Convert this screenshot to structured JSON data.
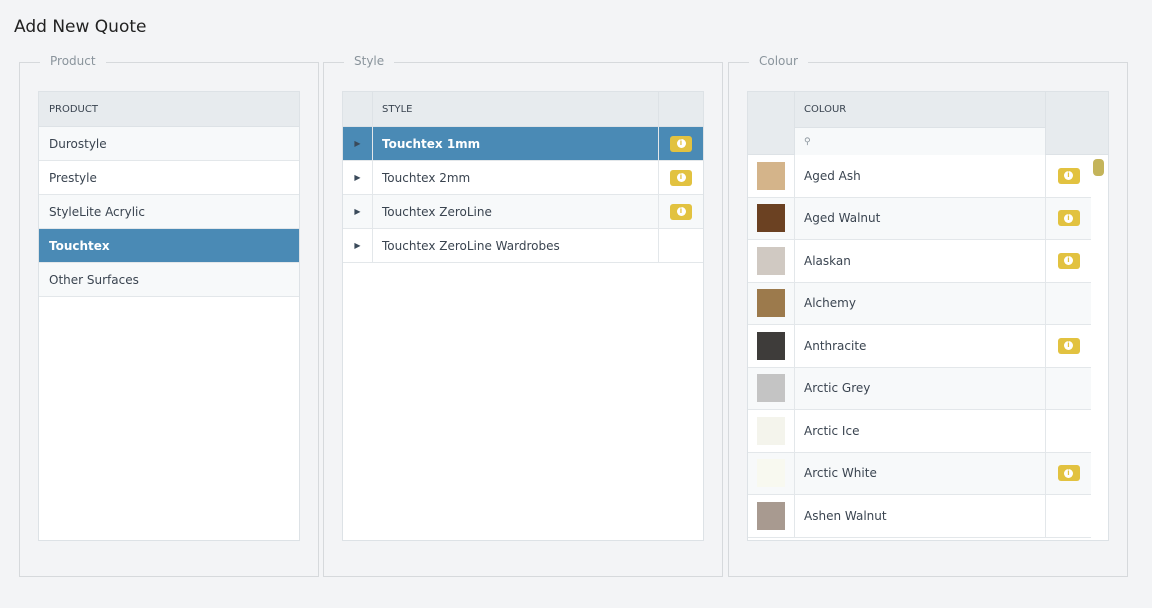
{
  "title": "Add New Quote",
  "product": {
    "legend": "Product",
    "header": "PRODUCT",
    "items": [
      "Durostyle",
      "Prestyle",
      "StyleLite Acrylic",
      "Touchtex",
      "Other Surfaces"
    ],
    "selected": 3
  },
  "style": {
    "legend": "Style",
    "header": "STYLE",
    "items": [
      {
        "name": "Touchtex 1mm",
        "info": true
      },
      {
        "name": "Touchtex 2mm",
        "info": true
      },
      {
        "name": "Touchtex ZeroLine",
        "info": true
      },
      {
        "name": "Touchtex ZeroLine Wardrobes",
        "info": false
      }
    ],
    "selected": 0
  },
  "colour": {
    "legend": "Colour",
    "header": "COLOUR",
    "search_placeholder": "",
    "items": [
      {
        "name": "Aged Ash",
        "swatch": "#d4b48a",
        "info": true
      },
      {
        "name": "Aged Walnut",
        "swatch": "#6b4122",
        "info": true
      },
      {
        "name": "Alaskan",
        "swatch": "#d0c9c2",
        "info": true
      },
      {
        "name": "Alchemy",
        "swatch": "#9c7a4c",
        "info": false
      },
      {
        "name": "Anthracite",
        "swatch": "#3e3c3a",
        "info": true
      },
      {
        "name": "Arctic Grey",
        "swatch": "#c4c4c4",
        "info": false
      },
      {
        "name": "Arctic Ice",
        "swatch": "#f4f4ec",
        "info": false
      },
      {
        "name": "Arctic White",
        "swatch": "#f8f9f0",
        "info": true
      },
      {
        "name": "Ashen Walnut",
        "swatch": "#a89a90",
        "info": false
      }
    ]
  },
  "colors": {
    "accent": "#4a8ab5",
    "info": "#e2c240",
    "scrollbar": "#c4b45a"
  }
}
